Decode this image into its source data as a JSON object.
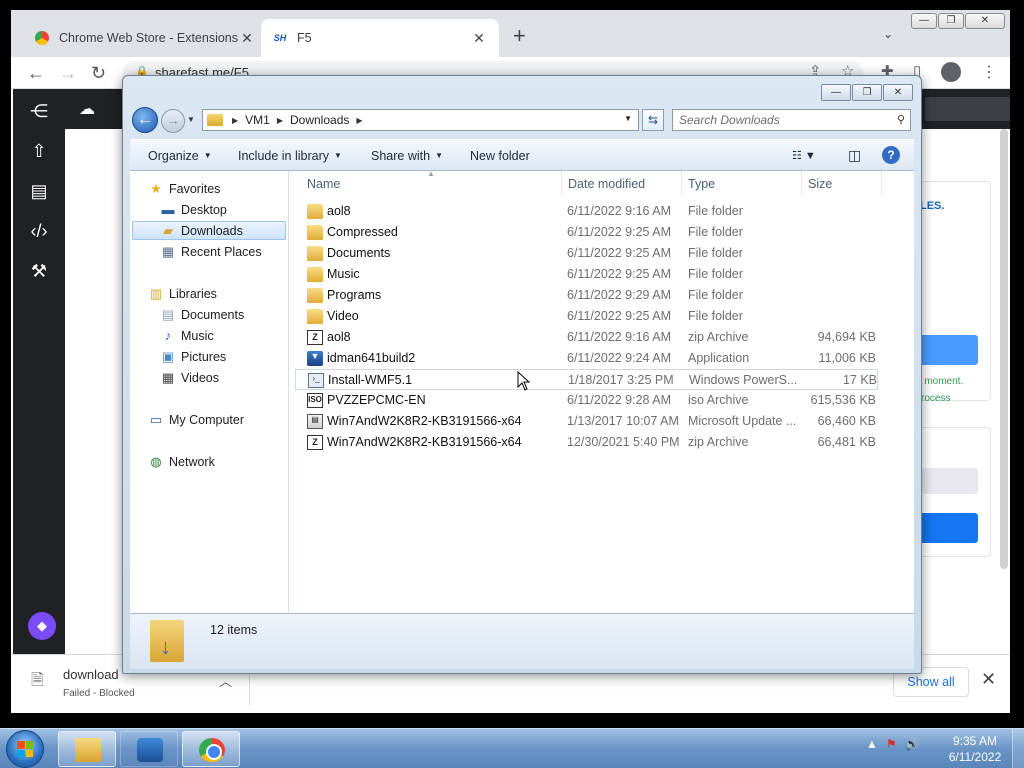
{
  "browser": {
    "tabs": [
      {
        "title": "Chrome Web Store - Extensions",
        "active": false
      },
      {
        "title": "F5",
        "favicon_text": "SH",
        "active": true
      }
    ],
    "url": "sharefast.me/F5"
  },
  "page": {
    "right_card_text": "LES.",
    "moment_text_1": "a moment.",
    "moment_text_2": "rocess"
  },
  "download_shelf": {
    "filename": "download",
    "status": "Failed - Blocked",
    "show_all": "Show all"
  },
  "explorer": {
    "breadcrumb": [
      "VM1",
      "Downloads"
    ],
    "search_placeholder": "Search Downloads",
    "commands": {
      "organize": "Organize",
      "include": "Include in library",
      "share": "Share with",
      "new_folder": "New folder"
    },
    "nav": {
      "favorites": "Favorites",
      "desktop": "Desktop",
      "downloads": "Downloads",
      "recent": "Recent Places",
      "libraries": "Libraries",
      "documents": "Documents",
      "music": "Music",
      "pictures": "Pictures",
      "videos": "Videos",
      "computer": "My Computer",
      "network": "Network"
    },
    "columns": {
      "name": "Name",
      "date": "Date modified",
      "type": "Type",
      "size": "Size"
    },
    "files": [
      {
        "name": "aol8",
        "date": "6/11/2022 9:16 AM",
        "type": "File folder",
        "size": "",
        "icon": "folder"
      },
      {
        "name": "Compressed",
        "date": "6/11/2022 9:25 AM",
        "type": "File folder",
        "size": "",
        "icon": "folder"
      },
      {
        "name": "Documents",
        "date": "6/11/2022 9:25 AM",
        "type": "File folder",
        "size": "",
        "icon": "folder"
      },
      {
        "name": "Music",
        "date": "6/11/2022 9:25 AM",
        "type": "File folder",
        "size": "",
        "icon": "folder"
      },
      {
        "name": "Programs",
        "date": "6/11/2022 9:29 AM",
        "type": "File folder",
        "size": "",
        "icon": "folder"
      },
      {
        "name": "Video",
        "date": "6/11/2022 9:25 AM",
        "type": "File folder",
        "size": "",
        "icon": "folder"
      },
      {
        "name": "aol8",
        "date": "6/11/2022 9:16 AM",
        "type": "zip Archive",
        "size": "94,694 KB",
        "icon": "zip"
      },
      {
        "name": "idman641build2",
        "date": "6/11/2022 9:24 AM",
        "type": "Application",
        "size": "11,006 KB",
        "icon": "app"
      },
      {
        "name": "Install-WMF5.1",
        "date": "1/18/2017 3:25 PM",
        "type": "Windows PowerS...",
        "size": "17 KB",
        "icon": "ps"
      },
      {
        "name": "PVZZEPCMC-EN",
        "date": "6/11/2022 9:28 AM",
        "type": "iso Archive",
        "size": "615,536 KB",
        "icon": "iso"
      },
      {
        "name": "Win7AndW2K8R2-KB3191566-x64",
        "date": "1/13/2017 10:07 AM",
        "type": "Microsoft Update ...",
        "size": "66,460 KB",
        "icon": "msu"
      },
      {
        "name": "Win7AndW2K8R2-KB3191566-x64",
        "date": "12/30/2021 5:40 PM",
        "type": "zip Archive",
        "size": "66,481 KB",
        "icon": "zip"
      }
    ],
    "item_count": "12 items"
  },
  "taskbar": {
    "time": "9:35 AM",
    "date": "6/11/2022"
  },
  "colors": {
    "taskbar": "#6a94c6",
    "chrome_tabstrip": "#dee1e6",
    "explorer_frame": "#c8d9ea",
    "accent_blue": "#1a73e8"
  }
}
